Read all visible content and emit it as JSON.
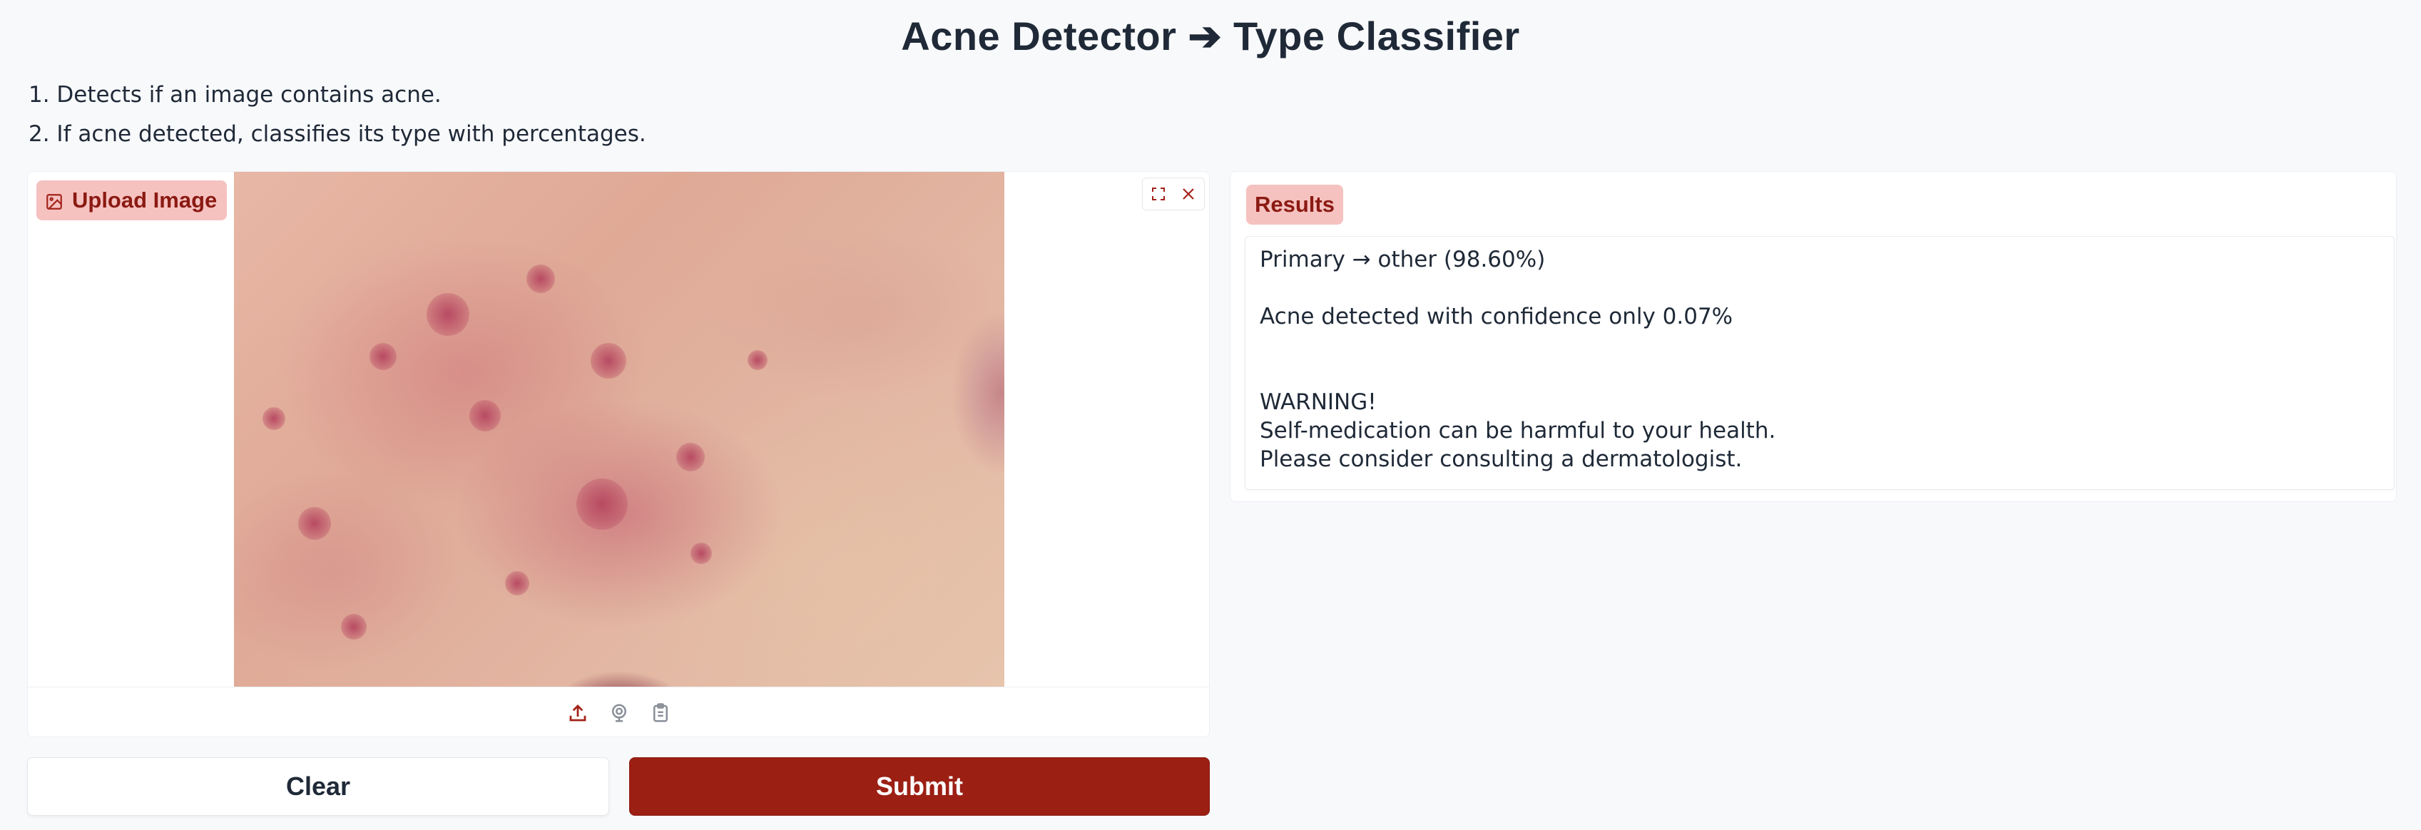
{
  "header": {
    "title": "Acne Detector ➔ Type Classifier"
  },
  "description": {
    "line1": "1. Detects if an image contains acne.",
    "line2": "2. If acne detected, classifies its type with percentages."
  },
  "input": {
    "badge_label": "Upload Image",
    "badge_icon": "image-icon",
    "tool_icons": [
      "fullscreen-icon",
      "close-icon"
    ],
    "source_icons": [
      "upload-icon",
      "webcam-icon",
      "clipboard-icon"
    ]
  },
  "buttons": {
    "clear_label": "Clear",
    "submit_label": "Submit"
  },
  "results": {
    "badge_label": "Results",
    "lines": [
      "Primary → other (98.60%)",
      "",
      "Acne detected with confidence only 0.07%",
      "",
      "",
      "WARNING!",
      "Self-medication can be harmful to your health.",
      "Please consider consulting a dermatologist."
    ]
  },
  "colors": {
    "accent": "#9c1f14",
    "badge_bg": "#f5c2c0",
    "badge_text": "#8b1a12",
    "page_bg": "#f8f9fb"
  }
}
